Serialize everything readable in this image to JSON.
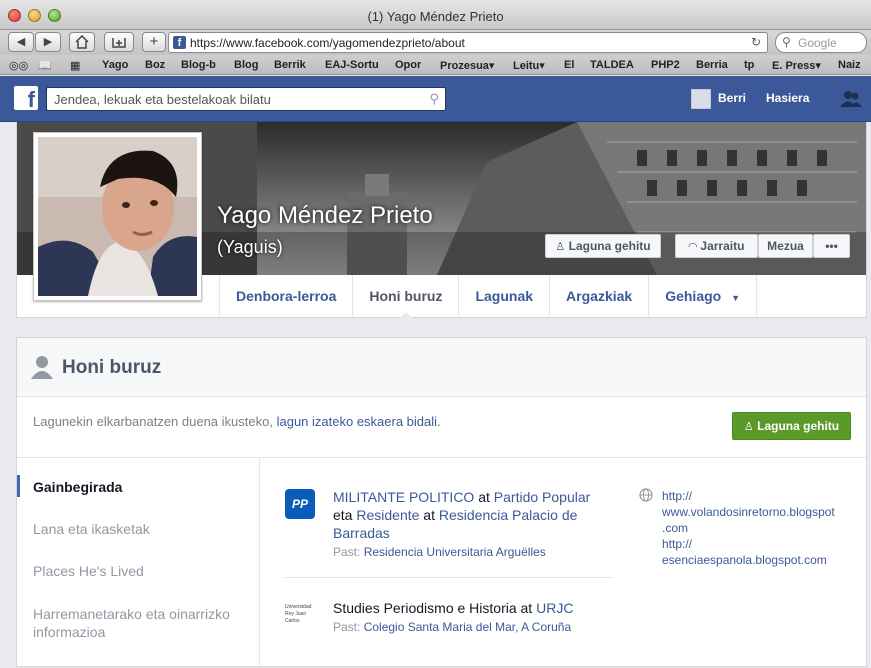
{
  "window": {
    "title": "(1) Yago Méndez Prieto"
  },
  "browser": {
    "url": "https://www.facebook.com/yagomendezprieto/about",
    "search_placeholder": "Google",
    "bookmarks": [
      "Yago",
      "Boz",
      "Blog-b",
      "Blog",
      "Berrik",
      "EAJ-Sortu",
      "Opor",
      "Prozesua▾",
      "Leitu▾",
      "El",
      "TALDEA",
      "PHP2",
      "Berria",
      "tp",
      "E. Press▾",
      "Naiz"
    ]
  },
  "fb_header": {
    "search_placeholder": "Jendea, lekuak eta bestelakoak bilatu",
    "user_name": "Berri",
    "home_label": "Hasiera"
  },
  "profile": {
    "name": "Yago Méndez Prieto",
    "alt_name": "(Yaguis)",
    "buttons": {
      "add_friend": "Laguna gehitu",
      "follow": "Jarraitu",
      "message": "Mezua",
      "more": "•••"
    },
    "tabs": [
      "Denbora-lerroa",
      "Honi buruz",
      "Lagunak",
      "Argazkiak",
      "Gehiago"
    ]
  },
  "about": {
    "title": "Honi buruz",
    "notice_text": "Lagunekin elkarbanatzen duena ikusteko,",
    "notice_link": "lagun izateko eskaera bidali.",
    "add_friend_button": "Laguna gehitu",
    "nav": [
      "Gainbegirada",
      "Lana eta ikasketak",
      "Places He's Lived",
      "Harremanetarako eta oinarrizko",
      "informazioa"
    ],
    "work": {
      "logo_text": "PP",
      "role1": "MILITANTE POLITICO",
      "at1": "at",
      "org1": "Partido Popular",
      "and": "eta",
      "role2": "Residente",
      "at2": "at",
      "org2_line1": "Residencia Palacio de",
      "org2_line2": "Barradas",
      "past_label": "Past:",
      "past_value": "Residencia Universitaria Arguëlles"
    },
    "education": {
      "logo_text": "Universidad Rey Juan Carlos",
      "text": "Studies Periodismo e Historia at",
      "school": "URJC",
      "past_label": "Past:",
      "past_value": "Colegio Santa Maria del Mar, A Coruña"
    },
    "links": [
      "http://",
      "www.volandosinretorno.blogspot",
      ".com",
      "http://",
      "esenciaespanola.blogspot.com"
    ]
  }
}
